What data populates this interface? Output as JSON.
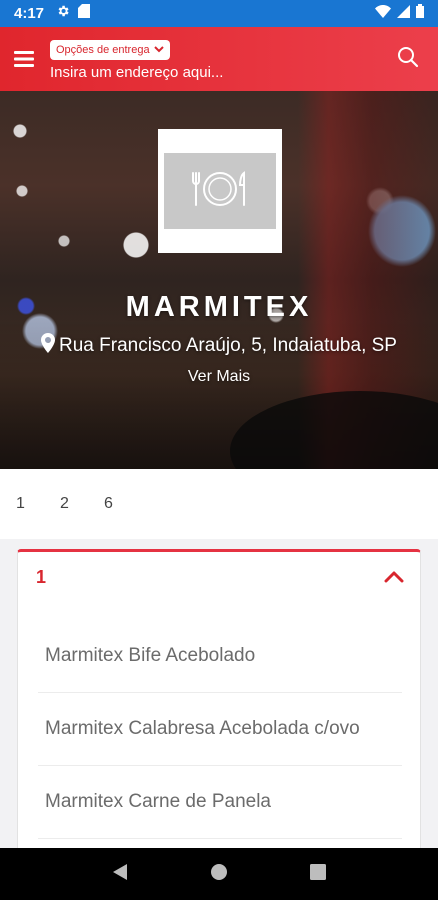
{
  "status_bar": {
    "time": "4:17",
    "icons": [
      "gear-icon",
      "sd-card-icon",
      "wifi-icon",
      "signal-icon",
      "battery-icon"
    ]
  },
  "app_bar": {
    "delivery_chip_label": "Opções de entrega",
    "address_placeholder": "Insira um endereço aqui...",
    "menu_icon": "hamburger-menu-icon",
    "search_icon": "search-icon"
  },
  "restaurant": {
    "name": "MARMITEX",
    "address": "Rua Francisco Araújo, 5, Indaiatuba, SP",
    "see_more": "Ver Mais"
  },
  "category_nav": [
    "1",
    "2",
    "6"
  ],
  "section": {
    "title": "1",
    "items": [
      "Marmitex Bife Acebolado",
      "Marmitex Calabresa Acebolada c/ovo",
      "Marmitex Carne de Panela"
    ]
  },
  "colors": {
    "status_bar": "#1976d2",
    "accent_red": "#e0262d",
    "nav_bar": "#000000"
  }
}
